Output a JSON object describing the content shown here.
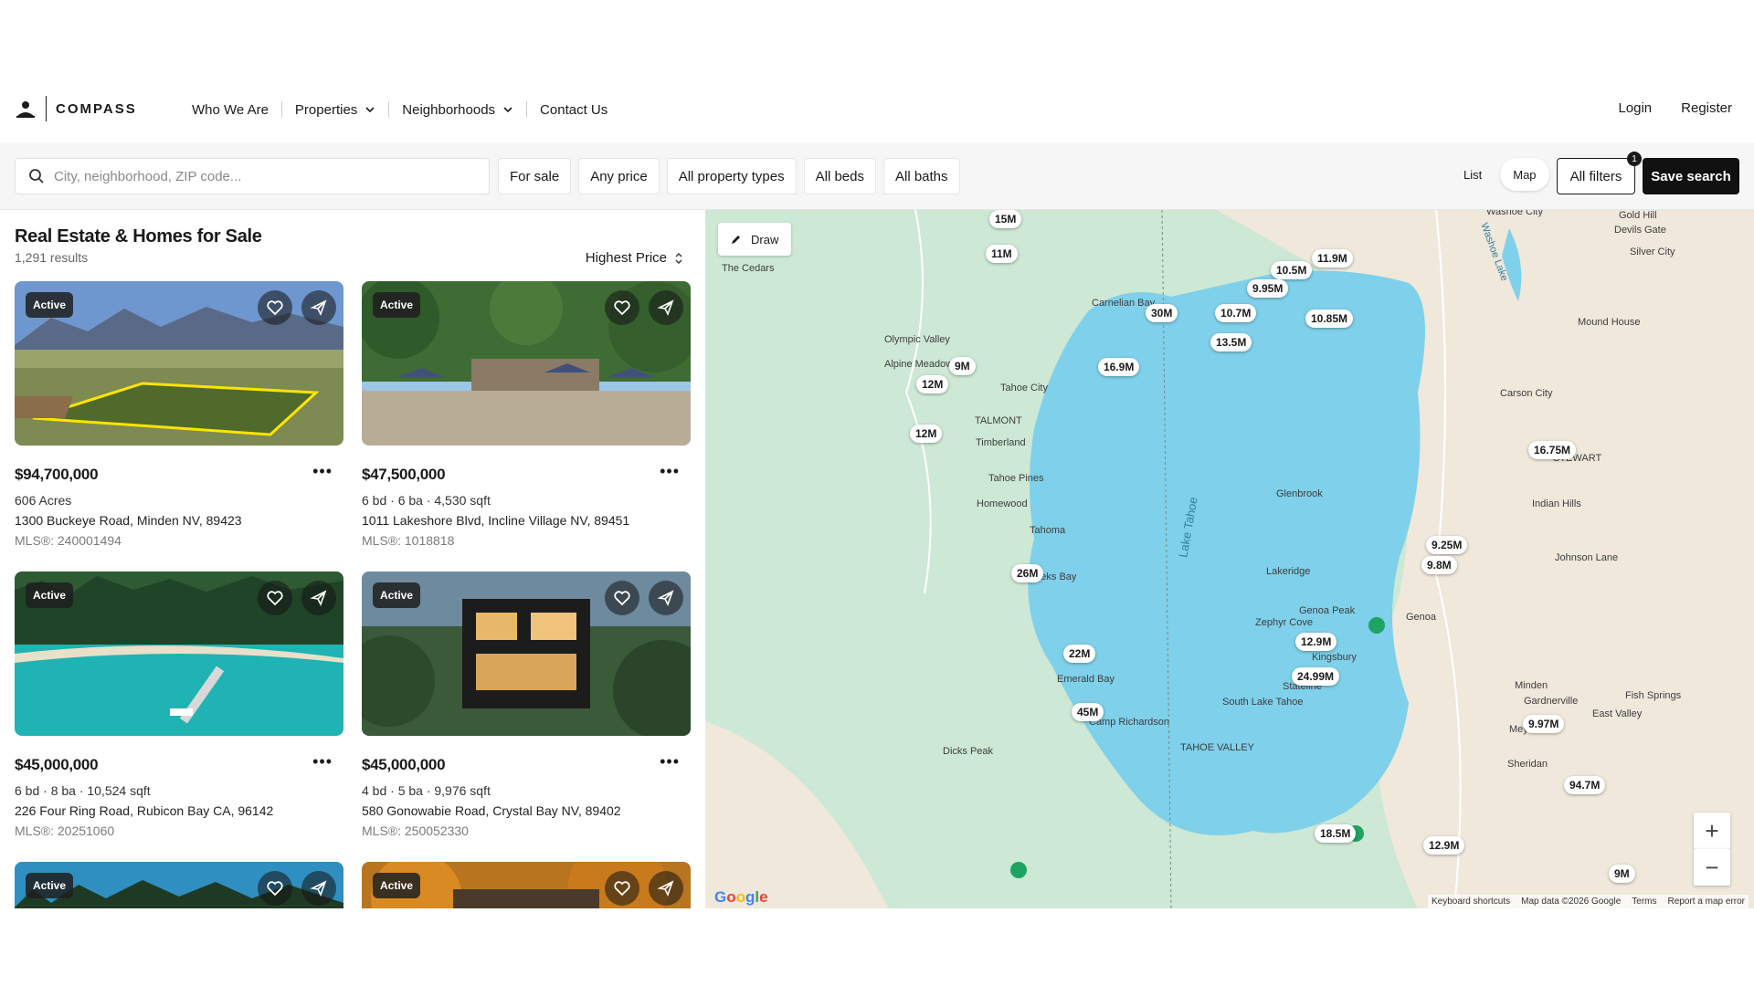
{
  "header": {
    "logo_text": "COMPASS",
    "nav": [
      "Who We Are",
      "Properties",
      "Neighborhoods",
      "Contact Us"
    ],
    "login": "Login",
    "register": "Register"
  },
  "search": {
    "placeholder": "City, neighborhood, ZIP code...",
    "filters": [
      "For sale",
      "Any price",
      "All property types",
      "All beds",
      "All baths"
    ],
    "view_list": "List",
    "view_map": "Map",
    "all_filters": "All filters",
    "filter_count": "1",
    "save_search": "Save search"
  },
  "results": {
    "title": "Real Estate & Homes for Sale",
    "count": "1,291 results",
    "sort": "Highest Price"
  },
  "listings": [
    {
      "status": "Active",
      "price": "$94,700,000",
      "details": "606 Acres",
      "address": "1300 Buckeye Road, Minden NV, 89423",
      "mls": "MLS®: 240001494"
    },
    {
      "status": "Active",
      "price": "$47,500,000",
      "details": "6 bd · 6 ba · 4,530 sqft",
      "address": "1011 Lakeshore Blvd, Incline Village NV, 89451",
      "mls": "MLS®: 1018818"
    },
    {
      "status": "Active",
      "price": "$45,000,000",
      "details": "6 bd · 8 ba · 10,524 sqft",
      "address": "226 Four Ring Road, Rubicon Bay CA, 96142",
      "mls": "MLS®: 20251060"
    },
    {
      "status": "Active",
      "price": "$45,000,000",
      "details": "4 bd · 5 ba · 9,976 sqft",
      "address": "580 Gonowabie Road, Crystal Bay NV, 89402",
      "mls": "MLS®: 250052330"
    },
    {
      "status": "Active"
    },
    {
      "status": "Active"
    }
  ],
  "map": {
    "draw": "Draw",
    "lake": "Lake Tahoe",
    "washoe": "Washoe Lake",
    "places": [
      "Washoe City",
      "Gold Hill",
      "Devils Gate",
      "Silver City",
      "The Cedars",
      "Carnelian Bay",
      "Mound House",
      "Olympic Valley",
      "Alpine Meadows",
      "Tahoe City",
      "Carson City",
      "STEWART",
      "TALMONT",
      "Timberland",
      "Tahoe Pines",
      "Homewood",
      "Tahoma",
      "Glenbrook",
      "Indian Hills",
      "Johnson Lane",
      "Meeks Bay",
      "Lakeridge",
      "Zephyr Cove",
      "Genoa",
      "Kingsbury",
      "Stateline",
      "Emerald Bay",
      "Minden",
      "Gardnerville",
      "Fish Springs",
      "East Valley",
      "South Lake Tahoe",
      "Camp Richardson",
      "TAHOE VALLEY",
      "Dicks Peak",
      "Genoa Peak",
      "Meyers",
      "Sheridan"
    ],
    "pins": [
      "15M",
      "11M",
      "9M",
      "12M",
      "12M",
      "30M",
      "10.7M",
      "10.5M",
      "11.9M",
      "9.95M",
      "10.85M",
      "13.5M",
      "16.9M",
      "16.75M",
      "9.25M",
      "9.8M",
      "26M",
      "22M",
      "45M",
      "12.9M",
      "24.99M",
      "9.97M",
      "94.7M",
      "18.5M",
      "12.9M",
      "9M"
    ],
    "attribution": [
      "Keyboard shortcuts",
      "Map data ©2026 Google",
      "Terms",
      "Report a map error"
    ],
    "zoom_in": "+",
    "zoom_out": "−",
    "google": "Google"
  },
  "colors": {
    "water": "#7fd0ea",
    "land": "#cde8d4",
    "brand": "#111111"
  }
}
